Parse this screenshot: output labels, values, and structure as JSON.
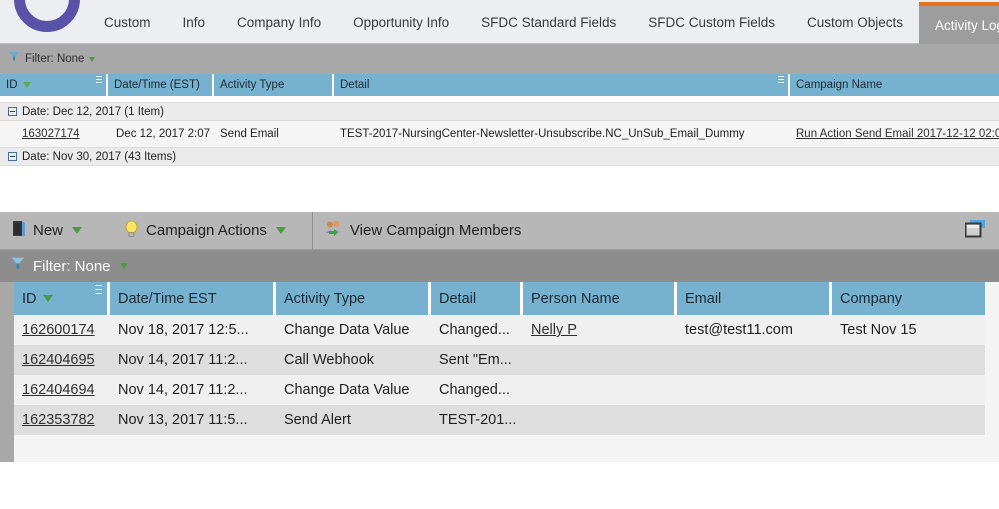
{
  "app": {
    "logo_name": "purple-circle-logo"
  },
  "top_panel": {
    "tabs": [
      {
        "label": "Custom",
        "active": false
      },
      {
        "label": "Info",
        "active": false
      },
      {
        "label": "Company Info",
        "active": false
      },
      {
        "label": "Opportunity Info",
        "active": false
      },
      {
        "label": "SFDC Standard Fields",
        "active": false
      },
      {
        "label": "SFDC Custom Fields",
        "active": false
      },
      {
        "label": "Custom Objects",
        "active": false
      },
      {
        "label": "Activity Log",
        "active": true
      }
    ],
    "active_tab_accent": "#e8721c",
    "filter": {
      "label": "Filter: None",
      "icon": "filter-funnel-icon"
    },
    "columns": [
      {
        "label": "ID",
        "sort_icon": "sort-desc-icon",
        "has_grip": true
      },
      {
        "label": "Date/Time (EST)",
        "has_grip": false
      },
      {
        "label": "Activity Type",
        "has_grip": false
      },
      {
        "label": "Detail",
        "has_grip": true
      },
      {
        "label": "Campaign Name",
        "has_grip": false
      }
    ],
    "groups": [
      {
        "label": "Date: Dec 12, 2017 (1 Item)",
        "expanded": true,
        "rows": [
          {
            "id": "163027174",
            "datetime": "Dec 12, 2017 2:07 ...",
            "activity_type": "Send Email",
            "detail": "TEST-2017-NursingCenter-Newsletter-Unsubscribe.NC_UnSub_Email_Dummy",
            "campaign_name": "Run Action Send Email 2017-12-12 02:0"
          }
        ]
      },
      {
        "label": "Date: Nov 30, 2017 (43 Items)",
        "expanded": true,
        "rows": []
      }
    ]
  },
  "bottom_panel": {
    "toolbar": {
      "new_label": "New",
      "new_icon": "document-icon",
      "campaign_actions_label": "Campaign Actions",
      "campaign_actions_icon": "lightbulb-icon",
      "view_members_label": "View Campaign Members",
      "view_members_icon": "users-green-arrow-icon",
      "panel_toggle_icon": "window-panel-icon"
    },
    "filter": {
      "label": "Filter: None",
      "icon": "filter-funnel-icon"
    },
    "columns": [
      {
        "label": "ID",
        "sort_icon": "sort-desc-icon",
        "has_grip": true
      },
      {
        "label": "Date/Time EST",
        "has_grip": false
      },
      {
        "label": "Activity Type",
        "has_grip": false
      },
      {
        "label": "Detail",
        "has_grip": false
      },
      {
        "label": "Person Name",
        "has_grip": false
      },
      {
        "label": "Email",
        "has_grip": false
      },
      {
        "label": "Company",
        "has_grip": false
      }
    ],
    "rows": [
      {
        "id": "162600174",
        "datetime": "Nov 18, 2017 12:5...",
        "activity_type": "Change Data Value",
        "detail": "Changed...",
        "person_name": "Nelly P",
        "email": "test@test11.com",
        "company": "Test Nov 15"
      },
      {
        "id": "162404695",
        "datetime": "Nov 14, 2017 11:2...",
        "activity_type": "Call Webhook",
        "detail": "Sent \"Em...",
        "person_name": "",
        "email": "",
        "company": ""
      },
      {
        "id": "162404694",
        "datetime": "Nov 14, 2017 11:2...",
        "activity_type": "Change Data Value",
        "detail": "Changed...",
        "person_name": "",
        "email": "",
        "company": ""
      },
      {
        "id": "162353782",
        "datetime": "Nov 13, 2017 11:5...",
        "activity_type": "Send Alert",
        "detail": "TEST-201...",
        "person_name": "",
        "email": "",
        "company": ""
      }
    ]
  }
}
